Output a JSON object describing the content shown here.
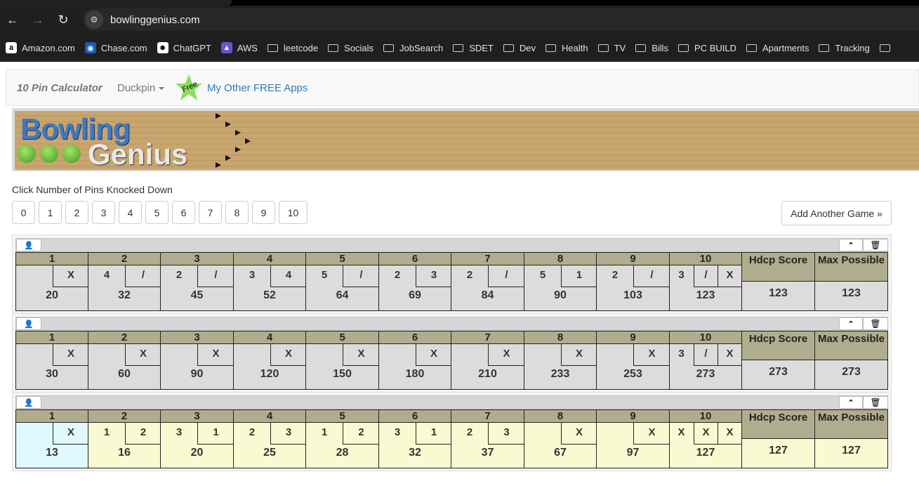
{
  "browser": {
    "url": "bowlinggenius.com",
    "bookmarks": [
      {
        "label": "Amazon.com",
        "icon": "amazon-icon",
        "type": "site"
      },
      {
        "label": "Chase.com",
        "icon": "chase-icon",
        "type": "site"
      },
      {
        "label": "ChatGPT",
        "icon": "chatgpt-icon",
        "type": "site"
      },
      {
        "label": "AWS",
        "icon": "aws-icon",
        "type": "site"
      },
      {
        "label": "leetcode",
        "type": "folder"
      },
      {
        "label": "Socials",
        "type": "folder"
      },
      {
        "label": "JobSearch",
        "type": "folder"
      },
      {
        "label": "SDET",
        "type": "folder"
      },
      {
        "label": "Dev",
        "type": "folder"
      },
      {
        "label": "Health",
        "type": "folder"
      },
      {
        "label": "TV",
        "type": "folder"
      },
      {
        "label": "Bills",
        "type": "folder"
      },
      {
        "label": "PC BUILD",
        "type": "folder"
      },
      {
        "label": "Apartments",
        "type": "folder"
      },
      {
        "label": "Tracking",
        "type": "folder"
      }
    ]
  },
  "navbar": {
    "brand": "10 Pin Calculator",
    "dropdown": "Duckpin",
    "star_text": "Free",
    "apps_link": "My Other FREE Apps"
  },
  "banner": {
    "line1": "Bowling",
    "line2": "Genius"
  },
  "instructions": "Click Number of Pins Knocked Down",
  "pin_buttons": [
    "0",
    "1",
    "2",
    "3",
    "4",
    "5",
    "6",
    "7",
    "8",
    "9",
    "10"
  ],
  "add_game": "Add Another Game »",
  "score_headers": {
    "hdcp": "Hdcp Score",
    "max": "Max Possible"
  },
  "colors": {
    "frame_header": "#b0ad8e",
    "frame_body": "#dcdcdc",
    "active_body": "#fafad2",
    "current_frame": "#dff9ff",
    "link": "#337ab7"
  },
  "games": [
    {
      "frames": [
        {
          "n": "1",
          "r1": "",
          "r2": "X",
          "total": "20"
        },
        {
          "n": "2",
          "r1": "4",
          "r2": "/",
          "total": "32"
        },
        {
          "n": "3",
          "r1": "2",
          "r2": "/",
          "total": "45"
        },
        {
          "n": "4",
          "r1": "3",
          "r2": "4",
          "total": "52"
        },
        {
          "n": "5",
          "r1": "5",
          "r2": "/",
          "total": "64"
        },
        {
          "n": "6",
          "r1": "2",
          "r2": "3",
          "total": "69"
        },
        {
          "n": "7",
          "r1": "2",
          "r2": "/",
          "total": "84"
        },
        {
          "n": "8",
          "r1": "5",
          "r2": "1",
          "total": "90"
        },
        {
          "n": "9",
          "r1": "2",
          "r2": "/",
          "total": "103"
        },
        {
          "n": "10",
          "r1": "3",
          "r2": "/",
          "r3": "X",
          "total": "123"
        }
      ],
      "hdcp_score": "123",
      "max_possible": "123"
    },
    {
      "frames": [
        {
          "n": "1",
          "r1": "",
          "r2": "X",
          "total": "30"
        },
        {
          "n": "2",
          "r1": "",
          "r2": "X",
          "total": "60"
        },
        {
          "n": "3",
          "r1": "",
          "r2": "X",
          "total": "90"
        },
        {
          "n": "4",
          "r1": "",
          "r2": "X",
          "total": "120"
        },
        {
          "n": "5",
          "r1": "",
          "r2": "X",
          "total": "150"
        },
        {
          "n": "6",
          "r1": "",
          "r2": "X",
          "total": "180"
        },
        {
          "n": "7",
          "r1": "",
          "r2": "X",
          "total": "210"
        },
        {
          "n": "8",
          "r1": "",
          "r2": "X",
          "total": "233"
        },
        {
          "n": "9",
          "r1": "",
          "r2": "X",
          "total": "253"
        },
        {
          "n": "10",
          "r1": "3",
          "r2": "/",
          "r3": "X",
          "total": "273"
        }
      ],
      "hdcp_score": "273",
      "max_possible": "273"
    },
    {
      "frames": [
        {
          "n": "1",
          "r1": "",
          "r2": "X",
          "total": "13"
        },
        {
          "n": "2",
          "r1": "1",
          "r2": "2",
          "total": "16"
        },
        {
          "n": "3",
          "r1": "3",
          "r2": "1",
          "total": "20"
        },
        {
          "n": "4",
          "r1": "2",
          "r2": "3",
          "total": "25"
        },
        {
          "n": "5",
          "r1": "1",
          "r2": "2",
          "total": "28"
        },
        {
          "n": "6",
          "r1": "3",
          "r2": "1",
          "total": "32"
        },
        {
          "n": "7",
          "r1": "2",
          "r2": "3",
          "total": "37"
        },
        {
          "n": "8",
          "r1": "",
          "r2": "X",
          "total": "67"
        },
        {
          "n": "9",
          "r1": "",
          "r2": "X",
          "total": "97"
        },
        {
          "n": "10",
          "r1": "X",
          "r2": "X",
          "r3": "X",
          "total": "127"
        }
      ],
      "hdcp_score": "127",
      "max_possible": "127",
      "active": true
    }
  ]
}
